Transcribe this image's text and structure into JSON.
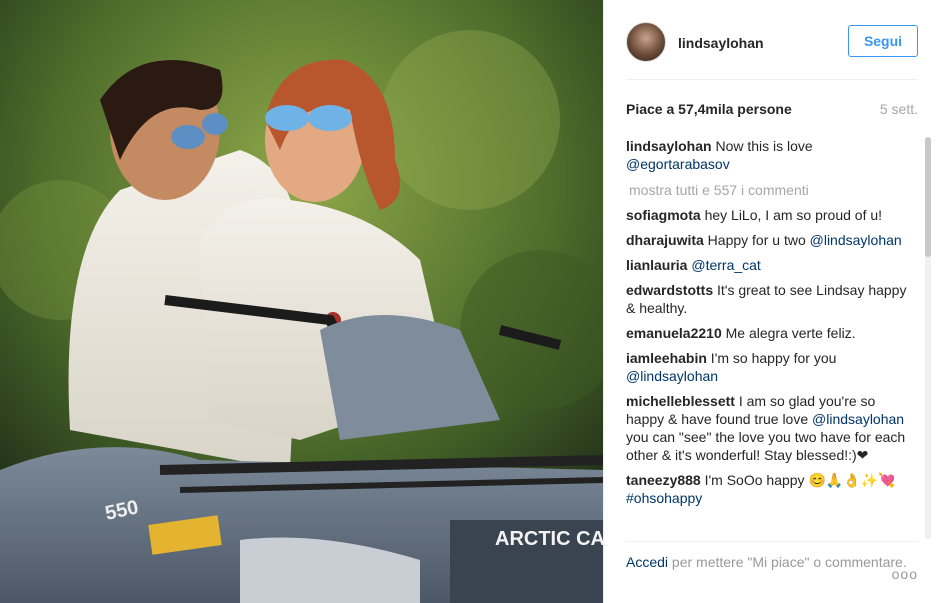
{
  "post": {
    "username": "lindsaylohan",
    "follow_label": "Segui",
    "likes": "Piace a 57,4mila persone",
    "age": "5 sett."
  },
  "caption": {
    "username": "lindsaylohan",
    "text": " Now this is love ",
    "mention": "@egortarabasov"
  },
  "show_all": "mostra tutti e 557 i commenti",
  "comments": [
    {
      "user": "sofiagmota",
      "text": " hey LiLo, I am so proud of u!",
      "mention": ""
    },
    {
      "user": "dharajuwita",
      "text": " Happy for u two ",
      "mention": "@lindsaylohan"
    },
    {
      "user": "lianlauria",
      "text": " ",
      "mention": "@terra_cat"
    },
    {
      "user": "edwardstotts",
      "text": " It's great to see Lindsay happy & healthy.",
      "mention": ""
    },
    {
      "user": "emanuela2210",
      "text": " Me alegra verte feliz.",
      "mention": ""
    },
    {
      "user": "iamleehabin",
      "text": " I'm so happy for you ",
      "mention": "@lindsaylohan"
    },
    {
      "user": "michelleblessett",
      "text": " I am so glad you're so happy & have found true love ",
      "mention": "@lindsaylohan",
      "text2": " you can \"see\" the love you two have for each other & it's wonderful! Stay blessed!:)❤"
    },
    {
      "user": "taneezy888",
      "text": " I'm SoOo happy 😊🙏👌✨💘",
      "mention": "#ohsohappy"
    }
  ],
  "footer": {
    "login_label": "Accedi",
    "text": " per mettere \"Mi piace\" o commentare.",
    "more_label": "ooo"
  },
  "photo": {
    "brand_text": "ARCTIC CAT",
    "model_text": "550"
  },
  "icons": {
    "avatar": "profile-photo",
    "options": "more-options-icon"
  },
  "colors": {
    "accent": "#3897f0",
    "mention": "#003569",
    "muted": "#a6a6a6"
  }
}
